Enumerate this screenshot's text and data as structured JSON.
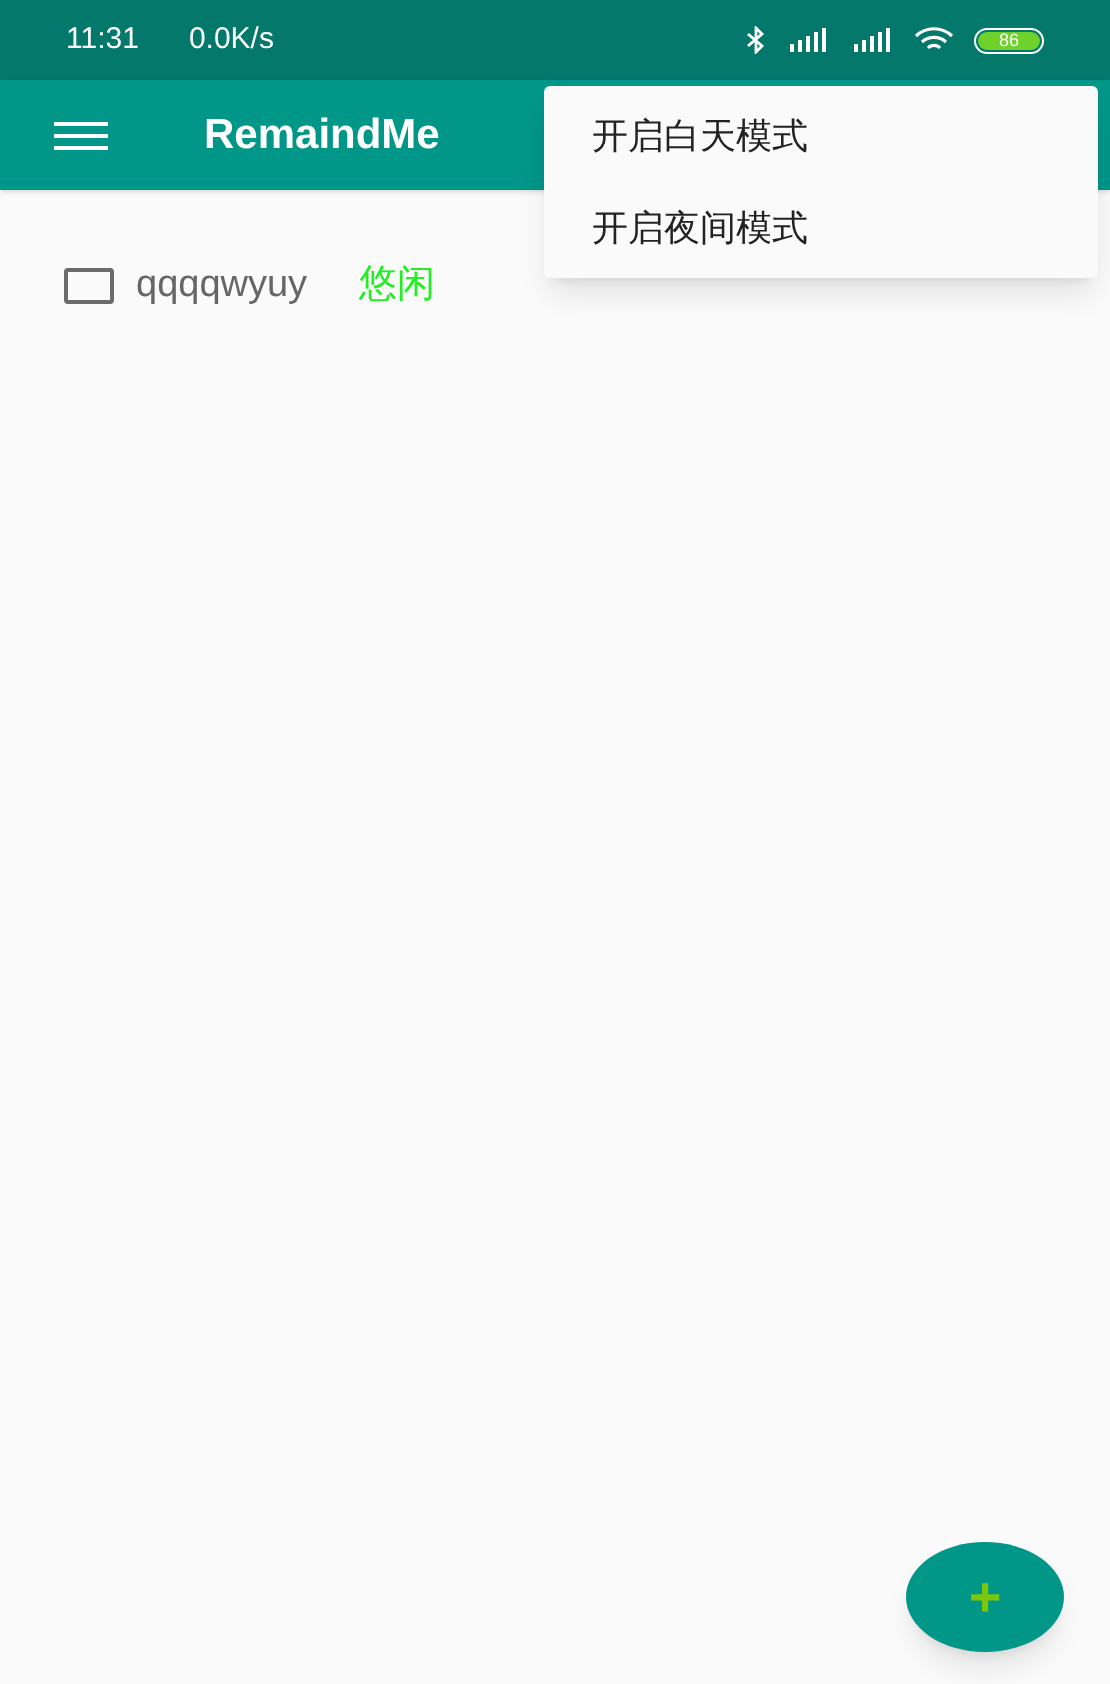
{
  "status_bar": {
    "time": "11:31",
    "speed": "0.0K/s",
    "battery": "86"
  },
  "app_bar": {
    "title": "RemaindMe"
  },
  "menu": {
    "items": [
      {
        "label": "开启白天模式"
      },
      {
        "label": "开启夜间模式"
      }
    ]
  },
  "tasks": [
    {
      "name": "qqqqwyuy",
      "checked": false,
      "tag": "悠闲",
      "color": "#22ee22"
    }
  ],
  "fab": {
    "label": "+"
  }
}
